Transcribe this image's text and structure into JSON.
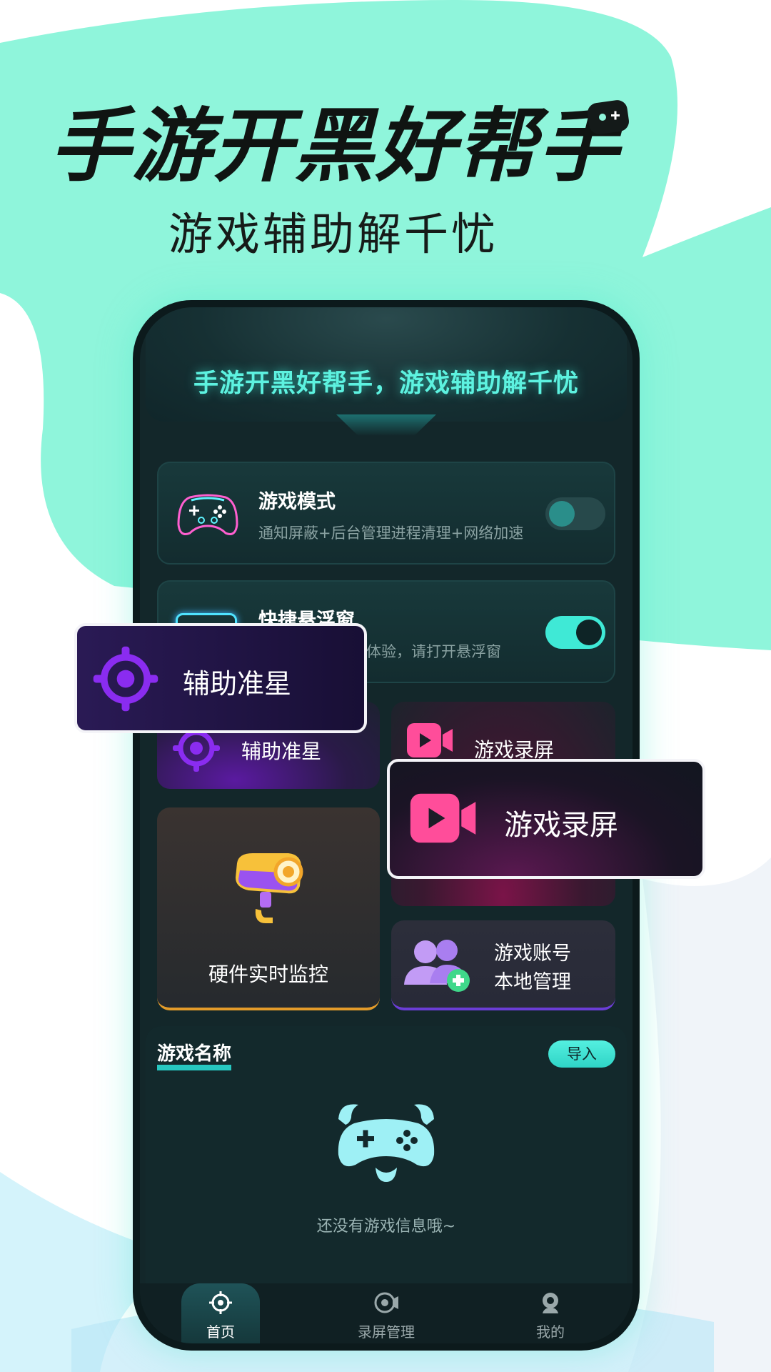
{
  "hero": {
    "title": "手游开黑好帮手",
    "subtitle": "游戏辅助解千忧"
  },
  "banner": {
    "text": "手游开黑好帮手，游戏辅助解千忧"
  },
  "features": {
    "game_mode": {
      "title": "游戏模式",
      "desc": "通知屏蔽+后台管理进程清理+网络加速",
      "enabled": false
    },
    "floating_window": {
      "title": "快捷悬浮窗",
      "desc": "戏体验，请打开悬浮窗",
      "enabled": true
    },
    "crosshair": {
      "label": "辅助准星"
    },
    "screen_record": {
      "label": "游戏录屏"
    },
    "hardware_monitor": {
      "label": "硬件实时监控"
    },
    "account_manage": {
      "line1": "游戏账号",
      "line2": "本地管理"
    }
  },
  "popups": {
    "crosshair": "辅助准星",
    "screen_record": "游戏录屏"
  },
  "games": {
    "header": "游戏名称",
    "import_label": "导入",
    "empty_text": "还没有游戏信息哦~"
  },
  "nav": {
    "items": [
      {
        "label": "首页",
        "icon": "crosshair-icon",
        "active": true
      },
      {
        "label": "录屏管理",
        "icon": "record-icon",
        "active": false
      },
      {
        "label": "我的",
        "icon": "profile-icon",
        "active": false
      }
    ]
  },
  "colors": {
    "mint": "#8ff5db",
    "accent": "#3fe9d6",
    "purple": "#8a2cf0",
    "pink": "#ff4d9a",
    "gold": "#f7c13a"
  }
}
